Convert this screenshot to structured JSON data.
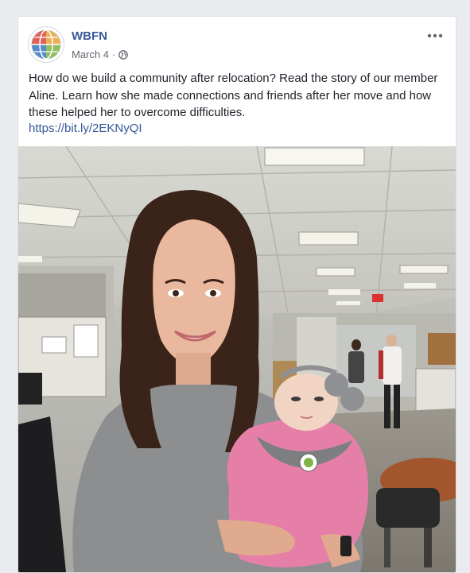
{
  "post": {
    "page_name": "WBFN",
    "date": "March 4",
    "separator": "·",
    "privacy_icon": "globe-icon",
    "more_icon": "more-options-icon",
    "text": "How do we build a community after relocation? Read the story of our member Aline. Learn how she made connections and friends after her move and how these helped her to overcome difficulties.",
    "link": "https://bit.ly/2EKNyQI",
    "photo_icon": "post-photo"
  },
  "colors": {
    "background": "#e9ebee",
    "card": "#ffffff",
    "link": "#365899",
    "text": "#1d2129",
    "meta": "#616770"
  }
}
